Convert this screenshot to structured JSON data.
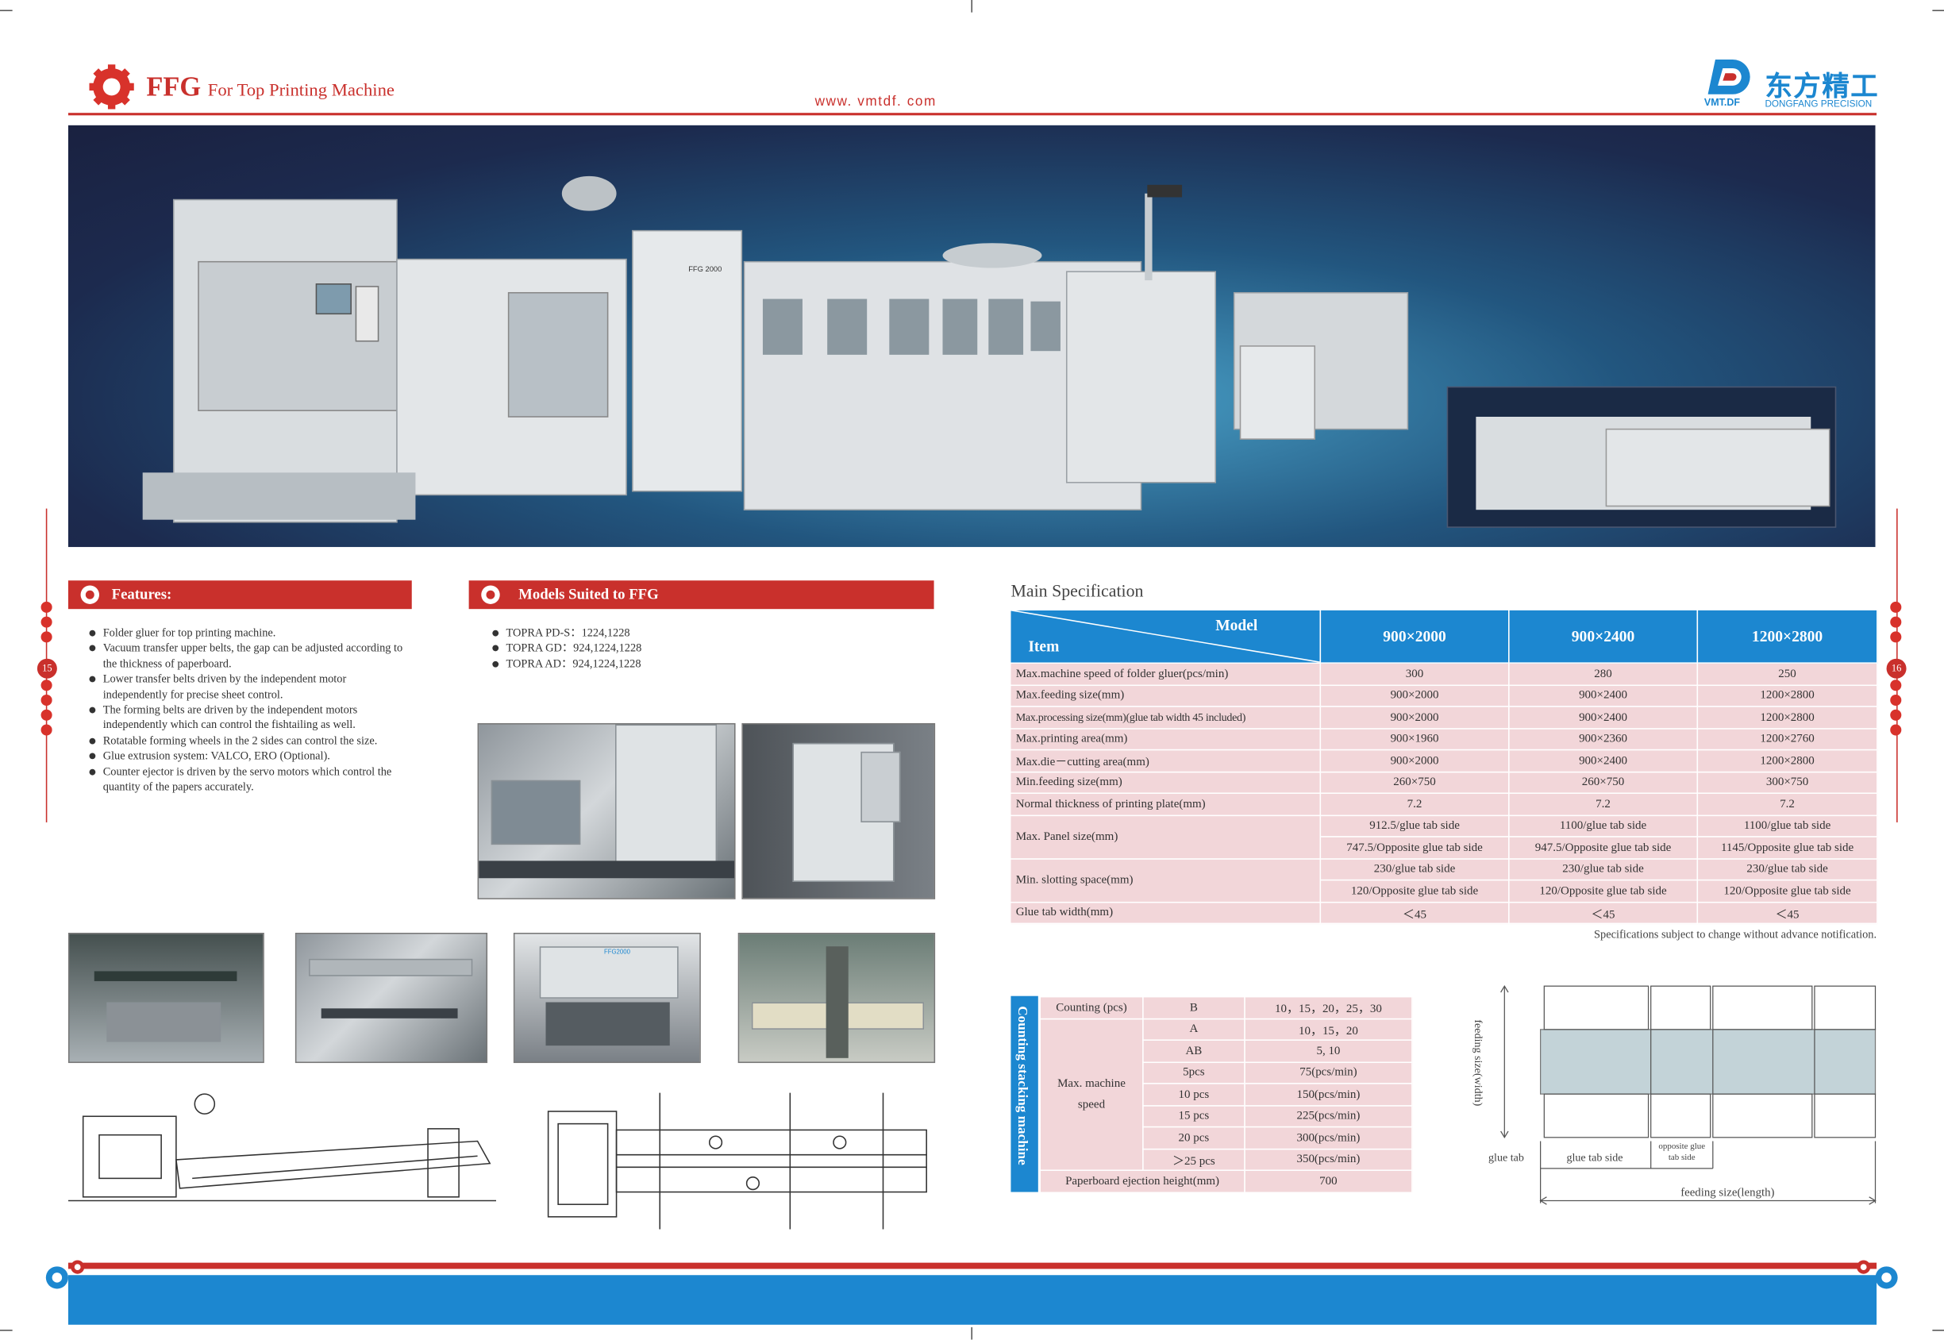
{
  "header": {
    "code": "FFG",
    "title": "For Top Printing Machine",
    "website": "www. vmtdf. com",
    "logo_cn": "东方精工",
    "logo_abbr": "VMT.DF",
    "logo_en": "DONGFANG PRECISION"
  },
  "page_numbers": {
    "left": "15",
    "right": "16"
  },
  "features": {
    "title": "Features:",
    "items": [
      "Folder gluer for top printing machine.",
      "Vacuum transfer upper belts, the gap can be adjusted according to the thickness of paperboard.",
      "Lower transfer belts driven by the independent motor independently for precise sheet control.",
      "The forming belts are driven by the independent motors independently which can control the fishtailing as well.",
      "Rotatable forming wheels in the 2 sides can control the size.",
      "Glue extrusion system: VALCO, ERO (Optional).",
      "Counter ejector is driven by the servo motors which control the quantity of the papers accurately."
    ]
  },
  "models": {
    "title": "Models Suited to FFG",
    "items": [
      "TOPRA PD-S：1224,1228",
      "TOPRA GD：924,1224,1228",
      "TOPRA AD：924,1224,1228"
    ]
  },
  "machine_labels": {
    "main_plate": "FFG 2000",
    "hood_plate": "FFG2000",
    "photo_plate": "FFG2000"
  },
  "spec": {
    "title": "Main Specification",
    "model_label": "Model",
    "item_label": "Item",
    "models": [
      "900×2000",
      "900×2400",
      "1200×2800"
    ],
    "rows": [
      {
        "item": "Max.machine speed of folder gluer(pcs/min)",
        "values": [
          "300",
          "280",
          "250"
        ]
      },
      {
        "item": "Max.feeding size(mm)",
        "values": [
          "900×2000",
          "900×2400",
          "1200×2800"
        ]
      },
      {
        "item": "Max.processing size(mm)(glue tab width 45 included)",
        "values": [
          "900×2000",
          "900×2400",
          "1200×2800"
        ]
      },
      {
        "item": "Max.printing area(mm)",
        "values": [
          "900×1960",
          "900×2360",
          "1200×2760"
        ]
      },
      {
        "item": "Max.die－cutting area(mm)",
        "values": [
          "900×2000",
          "900×2400",
          "1200×2800"
        ]
      },
      {
        "item": "Min.feeding size(mm)",
        "values": [
          "260×750",
          "260×750",
          "300×750"
        ]
      },
      {
        "item": "Normal thickness of printing plate(mm)",
        "values": [
          "7.2",
          "7.2",
          "7.2"
        ]
      }
    ],
    "panel": {
      "item": "Max. Panel size(mm)",
      "row1": [
        "912.5/glue tab side",
        "1100/glue tab side",
        "1100/glue tab side"
      ],
      "row2": [
        "747.5/Opposite glue tab side",
        "947.5/Opposite glue tab side",
        "1145/Opposite glue tab side"
      ]
    },
    "slot": {
      "item": "Min. slotting space(mm)",
      "row1": [
        "230/glue tab side",
        "230/glue tab side",
        "230/glue tab side"
      ],
      "row2": [
        "120/Opposite glue tab side",
        "120/Opposite glue tab side",
        "120/Opposite glue tab side"
      ]
    },
    "glue": {
      "item": "Glue tab width(mm)",
      "values": [
        "＜45",
        "＜45",
        "＜45"
      ]
    },
    "note": "Specifications subject to change without advance notification."
  },
  "counting": {
    "side_label": "Counting stacking machine",
    "counting_label": "Counting (pcs)",
    "counting_rows": [
      {
        "key": "B",
        "value": "10，15，20，25，30"
      },
      {
        "key": "A",
        "value": "10，15，20"
      },
      {
        "key": "AB",
        "value": "5, 10"
      }
    ],
    "speed_label": "Max. machine speed",
    "speed_rows": [
      {
        "key": "5pcs",
        "value": "75(pcs/min)"
      },
      {
        "key": "10 pcs",
        "value": "150(pcs/min)"
      },
      {
        "key": "15 pcs",
        "value": "225(pcs/min)"
      },
      {
        "key": "20 pcs",
        "value": "300(pcs/min)"
      },
      {
        "key": "＞25 pcs",
        "value": "350(pcs/min)"
      }
    ],
    "ejection_label": "Paperboard ejection height(mm)",
    "ejection_value": "700"
  },
  "diagram": {
    "width_label": "feeding size(width)",
    "glue_tab": "glue tab",
    "glue_tab_side": "glue tab side",
    "opposite_1": "opposite glue",
    "opposite_2": "tab side",
    "length_label": "feeding size(length)"
  },
  "colors": {
    "red": "#c9302c",
    "blue": "#1c87d0",
    "pink": "#f2d6d9",
    "navy": "#25345a"
  }
}
